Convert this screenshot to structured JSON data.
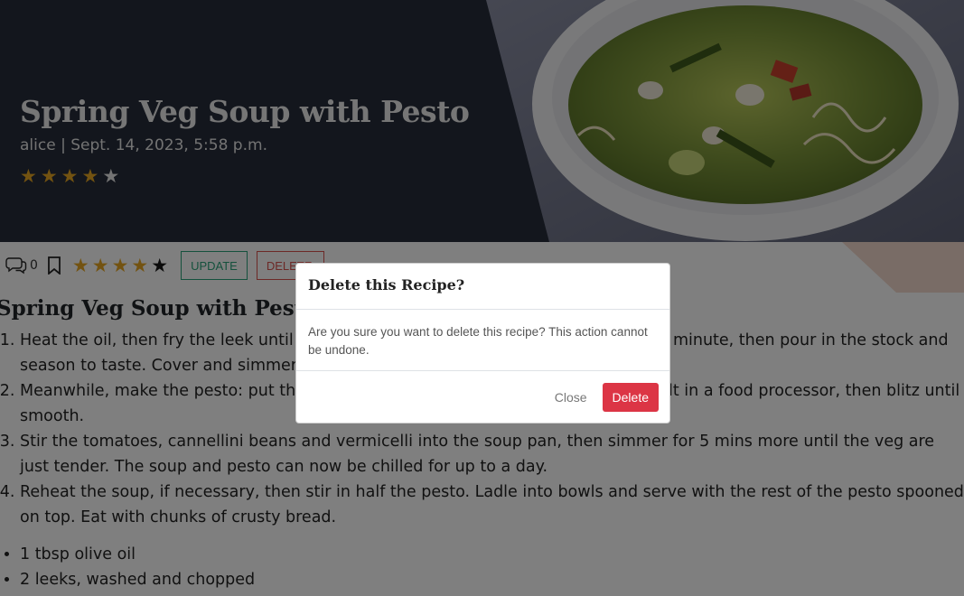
{
  "hero": {
    "title": "Spring Veg Soup with Pesto",
    "meta": "alice | Sept. 14, 2023, 5:58 p.m.",
    "rating": 4,
    "max_rating": 5
  },
  "actions": {
    "comment_count": "0",
    "rating": 4,
    "max_rating": 5,
    "update_label": "UPDATE",
    "delete_label": "DELETE"
  },
  "recipe": {
    "heading": "Spring Veg Soup with Pesto",
    "method": [
      "Heat the oil, then fry the leek until softened. Add the garlic and potato, cook for 1 minute, then pour in the stock and season to taste. Cover and simmer for 10 mins.",
      "Meanwhile, make the pesto: put the basil, parmesan, garlic, olive oil and ¼ tsp salt in a food processor, then blitz until smooth.",
      "Stir the tomatoes, cannellini beans and vermicelli into the soup pan, then simmer for 5 mins more until the veg are just tender. The soup and pesto can now be chilled for up to a day.",
      "Reheat the soup, if necessary, then stir in half the pesto. Ladle into bowls and serve with the rest of the pesto spooned on top. Eat with chunks of crusty bread."
    ],
    "ingredients": [
      "1 tbsp olive oil",
      "2 leeks, washed and chopped"
    ]
  },
  "modal": {
    "title": "Delete this Recipe?",
    "body": "Are you sure you want to delete this recipe? This action cannot be undone.",
    "close_label": "Close",
    "confirm_label": "Delete"
  },
  "colors": {
    "hero_bg": "#262d3a",
    "star_on": "#e7a623",
    "update_accent": "#2ba37a",
    "delete_accent": "#dc3545"
  }
}
